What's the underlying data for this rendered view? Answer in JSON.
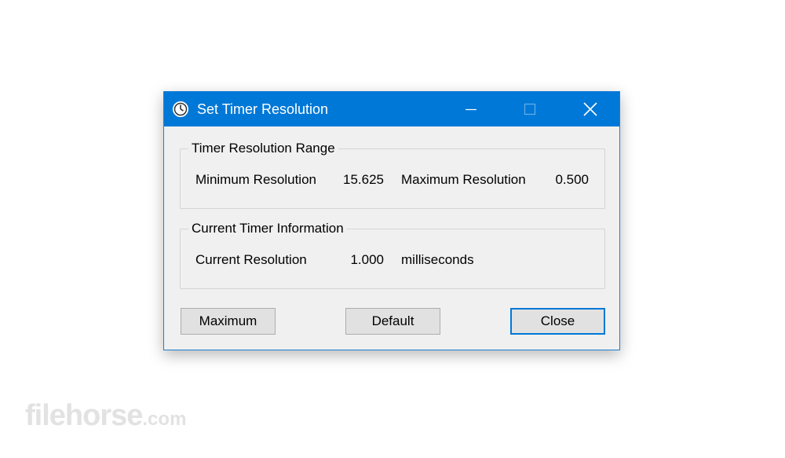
{
  "window": {
    "title": "Set Timer Resolution",
    "app_icon": "clock-icon",
    "controls": {
      "minimize": "minimize-icon",
      "maximize": "maximize-icon",
      "close": "close-icon"
    },
    "accent_color": "#0078d7"
  },
  "range_group": {
    "legend": "Timer Resolution Range",
    "min_label": "Minimum Resolution",
    "min_value": "15.625",
    "max_label": "Maximum Resolution",
    "max_value": "0.500"
  },
  "current_group": {
    "legend": "Current Timer Information",
    "current_label": "Current Resolution",
    "current_value": "1.000",
    "unit": "milliseconds"
  },
  "buttons": {
    "maximum": "Maximum",
    "default": "Default",
    "close": "Close"
  },
  "watermark": {
    "brand": "filehorse",
    "suffix": ".com"
  }
}
